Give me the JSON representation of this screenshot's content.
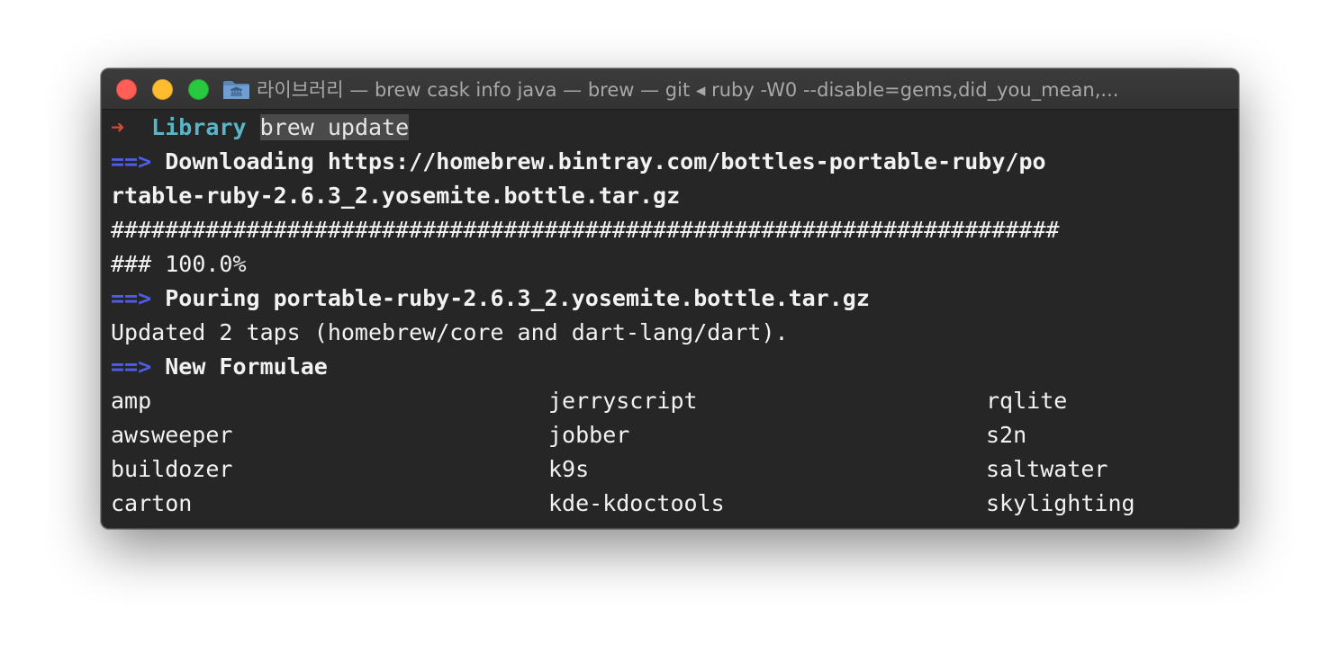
{
  "window": {
    "title": "라이브러리 — brew cask info java — brew — git ◂ ruby -W0 --disable=gems,did_you_mean,..."
  },
  "icons": {
    "close": "close-button",
    "minimize": "minimize-button",
    "zoom": "zoom-button",
    "folder": "folder-icon"
  },
  "terminal": {
    "prompt_arrow": "➜",
    "prompt_dir": "Library",
    "command": "brew update",
    "arrow_marker": "==>",
    "download_label": "Downloading https://homebrew.bintray.com/bottles-portable-ruby/po",
    "download_label_cont": "rtable-ruby-2.6.3_2.yosemite.bottle.tar.gz",
    "progress_hashes": "######################################################################",
    "progress_hashes_cont": "###",
    "progress_percent": "100.0%",
    "pouring": "Pouring portable-ruby-2.6.3_2.yosemite.bottle.tar.gz",
    "updated_taps": "Updated 2 taps (homebrew/core and dart-lang/dart).",
    "new_formulae_header": "New Formulae",
    "formulae": [
      [
        "amp",
        "jerryscript",
        "rqlite"
      ],
      [
        "awsweeper",
        "jobber",
        "s2n"
      ],
      [
        "buildozer",
        "k9s",
        "saltwater"
      ],
      [
        "carton",
        "kde-kdoctools",
        "skylighting"
      ]
    ]
  },
  "colors": {
    "terminal_bg": "#262626",
    "prompt_arrow": "#d24b36",
    "directory": "#58b6c8",
    "marker_blue": "#4d5de8"
  }
}
